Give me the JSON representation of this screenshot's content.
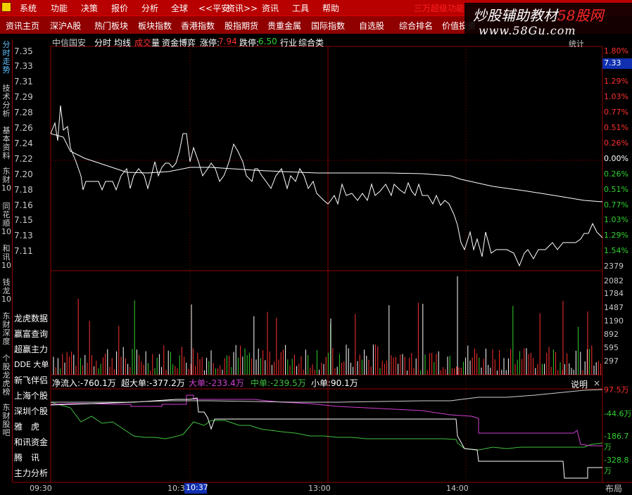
{
  "menubar": {
    "items": [
      "系统",
      "功能",
      "决策",
      "报价",
      "分析",
      "全球",
      "<<平安",
      "资讯>>",
      "资讯",
      "工具",
      "帮助"
    ],
    "right_text": "三万超级功能"
  },
  "tabs": [
    "资讯主页",
    "深沪A股",
    "热门板块",
    "板块指数",
    "香港指数",
    "股指期货",
    "贵重金属",
    "国际指数",
    "自选股",
    "综合排名",
    "价值投资"
  ],
  "watermark": {
    "line1_a": "炒股辅助教材",
    "line1_b": "58股网",
    "line2": "www.58Gu.com"
  },
  "left_tabs": [
    "分时走势",
    "技术分析",
    "基本资料",
    "东财10",
    "同花顺10",
    "和讯10",
    "钱龙10",
    "东财深度",
    "个股龙虎榜",
    "东财股吧"
  ],
  "chart_header": {
    "stock": "中信国安",
    "view": "分时",
    "avg": "均线",
    "vol_a": "成交",
    "vol_b": "量",
    "game": "资金博弈",
    "limit_up_label": "涨停:",
    "limit_up": "7.94",
    "limit_down_label": "跌停:",
    "limit_down": "6.50",
    "industry_label": "行业",
    "industry": "综合类"
  },
  "stats_label": "统计",
  "price_axis": [
    "7.35",
    "7.33",
    "7.31",
    "7.29",
    "7.28",
    "7.26",
    "7.24",
    "7.22",
    "7.20",
    "7.18",
    "7.16",
    "7.15",
    "7.13",
    "7.11"
  ],
  "pct_axis": [
    "1.80%",
    "1.54%",
    "1.29%",
    "1.03%",
    "0.77%",
    "0.51%",
    "0.26%",
    "0.00%",
    "0.26%",
    "0.51%",
    "0.77%",
    "1.03%",
    "1.29%",
    "1.54%"
  ],
  "current_price": "7.33",
  "volume_axis": [
    "2379",
    "2082",
    "1784",
    "1487",
    "1190",
    "892",
    "595",
    "297"
  ],
  "side_list": [
    "龙虎数据",
    "赢富查询",
    "超赢主力",
    "DDE 大单",
    "新飞伴侣",
    "上海个股",
    "深圳个股",
    "雅　虎",
    "和讯资金",
    "腾　讯",
    "主力分析"
  ],
  "flow_header": {
    "net": "净流入:-760.1万",
    "xl": "超大单:-377.2万",
    "large": "大单:-233.4万",
    "mid": "中单:-239.5万",
    "small": "小单:90.1万"
  },
  "flow_axis": [
    "97.5万",
    "-44.6万",
    "-186.7万",
    "-328.8万"
  ],
  "explain_label": "说明",
  "close_label": "×",
  "time_axis": [
    "09:30",
    "10:3",
    "13:00",
    "14:00"
  ],
  "time_highlight": "10:37",
  "layout_label": "布局",
  "colors": {
    "up": "#ff3030",
    "down": "#30ff30",
    "price_line": "#ffffff",
    "avg_line": "#ffffff",
    "purple": "#d040d0",
    "green": "#40c040",
    "grid_red": "#900000"
  }
}
